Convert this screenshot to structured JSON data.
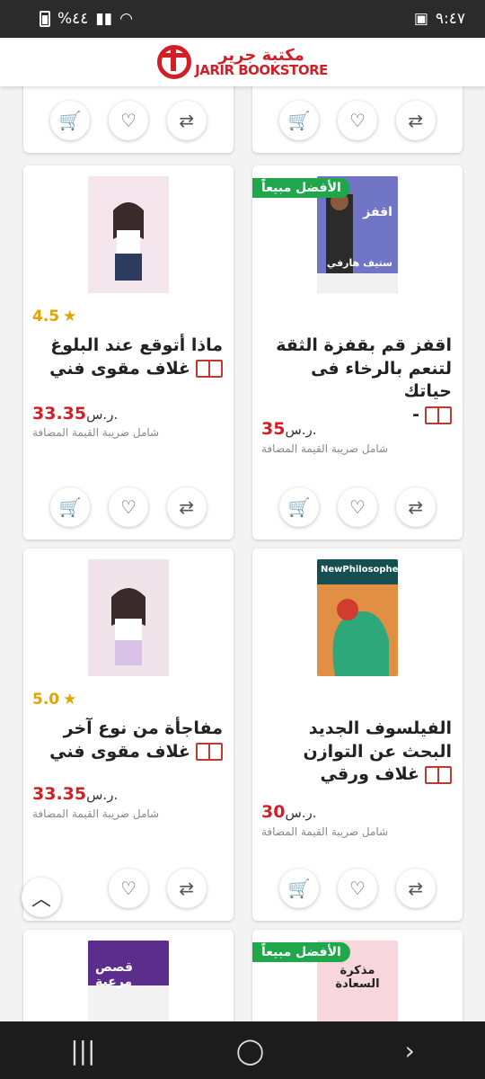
{
  "status": {
    "time": "٩:٤٧",
    "battery": "%٤٤"
  },
  "brand": {
    "ar": "مكتبة جرير",
    "en": "JARIR BOOKSTORE"
  },
  "products": [
    {
      "id": "p1",
      "title": "ماذا أتوقع عند البلوغ",
      "format": "غلاف مقوى فني",
      "rating": "4.5",
      "price": "33.35",
      "currency": "ر.س.",
      "vat": "شامل ضريبة القيمة المضافة",
      "badge": ""
    },
    {
      "id": "p2",
      "title": "اقفز قم بقفزة الثقة لتنعم بالرخاء فى حياتك",
      "format": "-",
      "rating": "",
      "price": "35",
      "currency": "ر.س.",
      "vat": "شامل ضريبة القيمة المضافة",
      "badge": "الأفضل مبيعاً"
    },
    {
      "id": "p3",
      "title": "مفاجأة من نوع آخر",
      "format": "غلاف مقوى فني",
      "rating": "5.0",
      "price": "33.35",
      "currency": "ر.س.",
      "vat": "شامل ضريبة القيمة المضافة",
      "badge": ""
    },
    {
      "id": "p4",
      "title": "الفيلسوف الجديد البحث عن التوازن",
      "format": "غلاف ورقي",
      "rating": "",
      "price": "30",
      "currency": "ر.س.",
      "vat": "شامل ضريبة القيمة المضافة",
      "badge": ""
    },
    {
      "id": "p5",
      "badge": ""
    },
    {
      "id": "p6",
      "badge": "الأفضل مبيعاً"
    }
  ],
  "covers": {
    "p2_title": "اقفز",
    "p2_author": "ستيف هارفي",
    "p4_brand": "NewPhilosopher",
    "p6_text": "مذكرة السعادة",
    "p5_text": "قصص مرعبة"
  },
  "colors": {
    "accent": "#d21f26",
    "badge": "#1fa84b",
    "star": "#e1a500"
  }
}
